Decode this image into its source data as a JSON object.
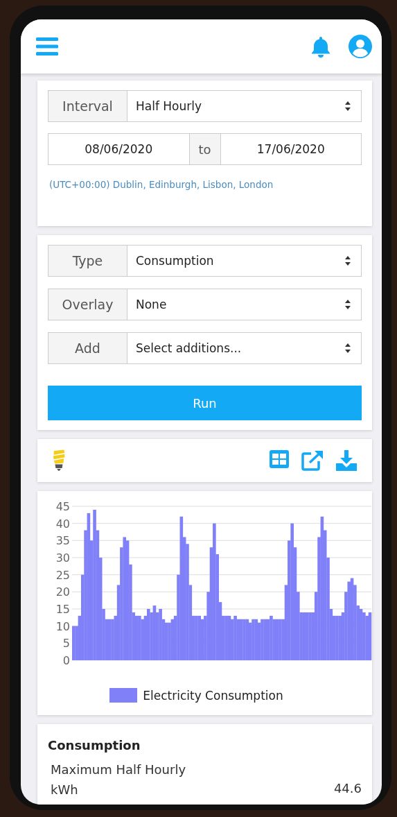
{
  "period": {
    "interval": {
      "label": "Interval",
      "value": "Half Hourly"
    },
    "date_range": {
      "from": "08/06/2020",
      "separator": "to",
      "to": "17/06/2020"
    },
    "timezone": "(UTC+00:00) Dublin, Edinburgh, Lisbon, London"
  },
  "options": [
    {
      "label": "Type",
      "value": "Consumption"
    },
    {
      "label": "Overlay",
      "value": "None"
    },
    {
      "label": "Add",
      "value": "Select additions..."
    }
  ],
  "run_button": "Run",
  "chart": {
    "chart_data": {
      "type": "bar",
      "grid": true,
      "ylim": [
        0,
        45
      ],
      "yticks": [
        0,
        5,
        10,
        15,
        20,
        25,
        30,
        35,
        40,
        45
      ],
      "series": [
        {
          "name": "Electricity Consumption",
          "color": "#8080f8",
          "values": [
            10,
            10,
            13,
            25,
            38,
            43,
            35,
            44,
            38,
            30,
            15,
            12,
            12,
            12,
            13,
            22,
            33,
            36,
            35,
            28,
            14,
            13,
            13,
            12,
            13,
            15,
            14,
            16,
            14,
            15,
            12,
            11,
            11,
            12,
            13,
            25,
            42,
            36,
            34,
            22,
            13,
            13,
            13,
            12,
            13,
            20,
            33,
            40,
            31,
            17,
            13,
            13,
            13,
            12,
            13,
            12,
            12,
            12,
            12,
            11,
            12,
            12,
            11,
            12,
            12,
            12,
            13,
            12,
            12,
            12,
            12,
            22,
            35,
            40,
            33,
            20,
            14,
            14,
            14,
            14,
            14,
            20,
            36,
            42,
            38,
            30,
            15,
            13,
            13,
            13,
            14,
            20,
            23,
            24,
            22,
            16,
            15,
            14,
            13,
            14
          ]
        }
      ]
    }
  },
  "summary": {
    "title": "Consumption",
    "rows": [
      {
        "label": "Maximum Half Hourly kWh",
        "value": "44.6"
      }
    ]
  }
}
